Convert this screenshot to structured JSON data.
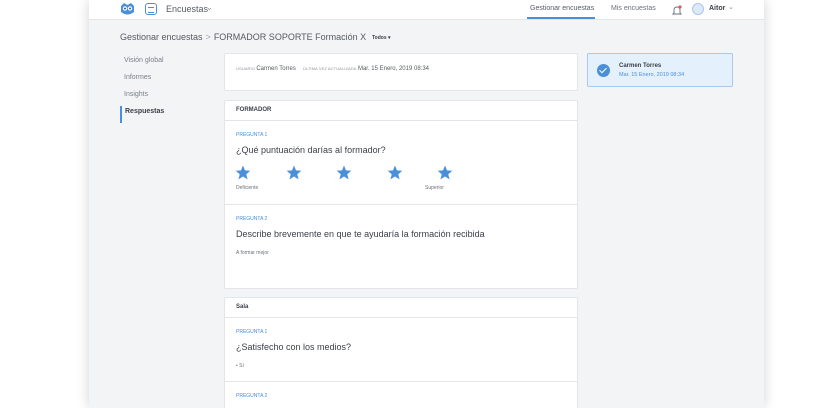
{
  "topbar": {
    "app_name": "Encuestas",
    "nav": [
      "Gestionar encuestas",
      "Mis encuestas"
    ],
    "user_name": "Aitor",
    "accent": "#4a90d9"
  },
  "breadcrumb": {
    "root": "Gestionar encuestas",
    "separator": ">",
    "current": "FORMADOR SOPORTE Formación X",
    "filter": "Todos ▾"
  },
  "sidebar": {
    "items": [
      "Visión global",
      "Informes",
      "Insights",
      "Respuestas"
    ],
    "active": "Respuestas"
  },
  "meta": {
    "user_key": "USUARIO",
    "user_value": "Carmen Torres",
    "updated_key": "ÚLTIMA VEZ ACTUALIZADA",
    "updated_value": "Mar. 15 Enero, 2019 08:34"
  },
  "sections": [
    {
      "title": "FORMADOR",
      "questions": [
        {
          "number": "PREGUNTA 1",
          "text": "¿Qué puntuación darías al formador?",
          "rating": 5,
          "min_label": "Deficiente",
          "max_label": "Superior"
        },
        {
          "number": "PREGUNTA 2",
          "text": "Describe brevemente en que te ayudaría la formación recibida",
          "answer": "A formar mejor"
        }
      ]
    },
    {
      "title": "Sala",
      "questions": [
        {
          "number": "PREGUNTA 1",
          "text": "¿Satisfecho con los medios?",
          "answer": "•   Sí"
        },
        {
          "number": "PREGUNTA 2"
        }
      ]
    }
  ],
  "respondent": {
    "name": "Carmen Torres",
    "date": "Mar. 15 Enero, 2019 08:34"
  },
  "icons": {
    "logo": "owl-logo-icon",
    "app": "survey-app-icon",
    "bell": "bell-icon",
    "avatar": "avatar-icon",
    "check": "check-circle-icon",
    "star": "star-icon"
  }
}
